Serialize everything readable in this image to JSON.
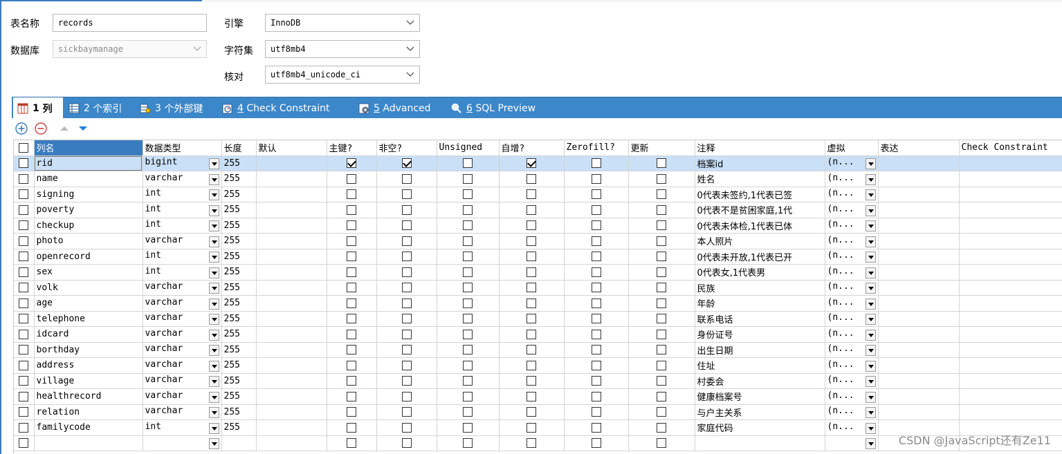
{
  "props": {
    "table_name_label": "表名称",
    "table_name_value": "records",
    "database_label": "数据库",
    "database_value": "sickbaymanage",
    "engine_label": "引擎",
    "engine_value": "InnoDB",
    "charset_label": "字符集",
    "charset_value": "utf8mb4",
    "collation_label": "核对",
    "collation_value": "utf8mb4_unicode_ci"
  },
  "tabs": [
    {
      "num": "1",
      "label": "列"
    },
    {
      "num": "2",
      "label": "个索引"
    },
    {
      "num": "3",
      "label": "个外部键"
    },
    {
      "num": "4",
      "label": "Check Constraint"
    },
    {
      "num": "5",
      "label": "Advanced"
    },
    {
      "num": "6",
      "label": "SQL Preview"
    }
  ],
  "columns": {
    "name": "列名",
    "type": "数据类型",
    "length": "长度",
    "default": "默认",
    "pk": "主键?",
    "notnull": "非空?",
    "unsigned": "Unsigned",
    "autoinc": "自增?",
    "zerofill": "Zerofill?",
    "update": "更新",
    "comment": "注释",
    "virtual": "虚拟",
    "expression": "表达",
    "check": "Check Constraint"
  },
  "rows": [
    {
      "name": "rid",
      "type": "bigint",
      "length": "255",
      "pk": true,
      "notnull": true,
      "autoinc": true,
      "comment": "档案id",
      "virtual": "(n..."
    },
    {
      "name": "name",
      "type": "varchar",
      "length": "255",
      "pk": false,
      "notnull": false,
      "autoinc": false,
      "comment": "姓名",
      "virtual": "(n..."
    },
    {
      "name": "signing",
      "type": "int",
      "length": "255",
      "pk": false,
      "notnull": false,
      "autoinc": false,
      "comment": "0代表未签约,1代表已签",
      "virtual": "(n..."
    },
    {
      "name": "poverty",
      "type": "int",
      "length": "255",
      "pk": false,
      "notnull": false,
      "autoinc": false,
      "comment": "0代表不是贫困家庭,1代",
      "virtual": "(n..."
    },
    {
      "name": "checkup",
      "type": "int",
      "length": "255",
      "pk": false,
      "notnull": false,
      "autoinc": false,
      "comment": "0代表未体检,1代表已体",
      "virtual": "(n..."
    },
    {
      "name": "photo",
      "type": "varchar",
      "length": "255",
      "pk": false,
      "notnull": false,
      "autoinc": false,
      "comment": "本人照片",
      "virtual": "(n..."
    },
    {
      "name": "openrecord",
      "type": "int",
      "length": "255",
      "pk": false,
      "notnull": false,
      "autoinc": false,
      "comment": "0代表未开放,1代表已开",
      "virtual": "(n..."
    },
    {
      "name": "sex",
      "type": "int",
      "length": "255",
      "pk": false,
      "notnull": false,
      "autoinc": false,
      "comment": "0代表女,1代表男",
      "virtual": "(n..."
    },
    {
      "name": "volk",
      "type": "varchar",
      "length": "255",
      "pk": false,
      "notnull": false,
      "autoinc": false,
      "comment": "民族",
      "virtual": "(n..."
    },
    {
      "name": "age",
      "type": "varchar",
      "length": "255",
      "pk": false,
      "notnull": false,
      "autoinc": false,
      "comment": "年龄",
      "virtual": "(n..."
    },
    {
      "name": "telephone",
      "type": "varchar",
      "length": "255",
      "pk": false,
      "notnull": false,
      "autoinc": false,
      "comment": "联系电话",
      "virtual": "(n..."
    },
    {
      "name": "idcard",
      "type": "varchar",
      "length": "255",
      "pk": false,
      "notnull": false,
      "autoinc": false,
      "comment": "身份证号",
      "virtual": "(n..."
    },
    {
      "name": "borthday",
      "type": "varchar",
      "length": "255",
      "pk": false,
      "notnull": false,
      "autoinc": false,
      "comment": "出生日期",
      "virtual": "(n..."
    },
    {
      "name": "address",
      "type": "varchar",
      "length": "255",
      "pk": false,
      "notnull": false,
      "autoinc": false,
      "comment": "住址",
      "virtual": "(n..."
    },
    {
      "name": "village",
      "type": "varchar",
      "length": "255",
      "pk": false,
      "notnull": false,
      "autoinc": false,
      "comment": "村委会",
      "virtual": "(n..."
    },
    {
      "name": "healthrecord",
      "type": "varchar",
      "length": "255",
      "pk": false,
      "notnull": false,
      "autoinc": false,
      "comment": "健康档案号",
      "virtual": "(n..."
    },
    {
      "name": "relation",
      "type": "varchar",
      "length": "255",
      "pk": false,
      "notnull": false,
      "autoinc": false,
      "comment": "与户主关系",
      "virtual": "(n..."
    },
    {
      "name": "familycode",
      "type": "int",
      "length": "255",
      "pk": false,
      "notnull": false,
      "autoinc": false,
      "comment": "家庭代码",
      "virtual": "(n..."
    }
  ],
  "watermark": "CSDN @JavaScript还有Ze11",
  "colors": {
    "accent": "#3c87c9",
    "selected_row": "#c9e0f7"
  }
}
